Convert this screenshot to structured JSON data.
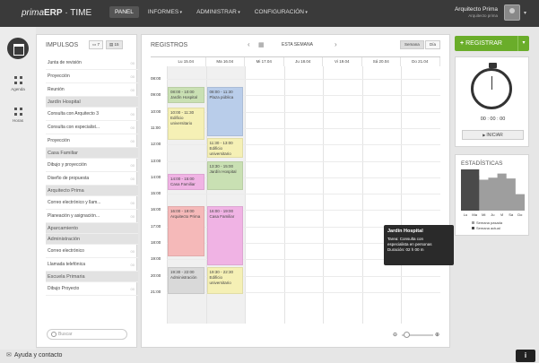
{
  "header": {
    "logo_italic": "prima",
    "logo_bold": "ERP",
    "logo_rest": " · TIME",
    "nav": [
      {
        "label": "PANEL",
        "active": true
      },
      {
        "label": "INFORMES",
        "caret": true
      },
      {
        "label": "ADMINISTRAR",
        "caret": true
      },
      {
        "label": "CONFIGURACIÓN",
        "caret": true
      }
    ],
    "user_name": "Arquitecto Prima",
    "user_role": "Arquitecto prima"
  },
  "left_nav": {
    "items": [
      {
        "label": "Agenda",
        "icon": "agenda-grid-icon"
      },
      {
        "label": "Horas",
        "icon": "hours-grid-icon"
      }
    ]
  },
  "impulsos": {
    "title": "IMPULSOS",
    "btn_day": "7",
    "btn_week": "15",
    "rows": [
      {
        "label": "Junta de revisión",
        "right": "00"
      },
      {
        "label": "Proyección",
        "right": "00"
      },
      {
        "label": "Reunión",
        "right": "00"
      },
      {
        "label": "Jardín Hospital",
        "group": true
      },
      {
        "label": "Consulta con Arquitecto 3",
        "right": "00"
      },
      {
        "label": "Consulta con especialist...",
        "right": "00"
      },
      {
        "label": "Proyección",
        "right": "00"
      },
      {
        "label": "Casa Familiar",
        "group": true
      },
      {
        "label": "Dibujo y proyección",
        "right": "00"
      },
      {
        "label": "Diseño de propuesta",
        "right": "00"
      },
      {
        "label": "Arquitecto Prima",
        "group": true
      },
      {
        "label": "Correo electrónico y llam...",
        "right": "00"
      },
      {
        "label": "Planeación y asignación...",
        "right": "00"
      },
      {
        "label": "Aparcamiento",
        "group": true
      },
      {
        "label": "Administración",
        "group": true
      },
      {
        "label": "Correo electrónico",
        "right": "00"
      },
      {
        "label": "Llamada telefónica",
        "right": "00"
      },
      {
        "label": "Escuela Primaria",
        "group": true
      },
      {
        "label": "Dibujo Proyecto",
        "right": "00"
      }
    ],
    "search_placeholder": "Buscar"
  },
  "registros": {
    "title": "REGISTROS",
    "week_label": "ESTA SEMANA",
    "toggle_week": "Semana",
    "toggle_day": "Día",
    "days": [
      "Lu 15.04",
      "Ma 16.04",
      "Mi 17.04",
      "Ju 18.04",
      "Vi 19.04",
      "Sá 20.04",
      "Do 21.04"
    ],
    "hours": [
      "08:00",
      "09:00",
      "10:00",
      "11:00",
      "12:00",
      "13:00",
      "14:00",
      "15:00",
      "16:00",
      "17:00",
      "18:00",
      "19:00",
      "20:00",
      "21:00"
    ],
    "events": [
      {
        "day": 0,
        "start": 8.5,
        "end": 9.5,
        "time": "08:00 - 10:00",
        "title": "Jardín Hospital",
        "color": "#c9e0b3"
      },
      {
        "day": 0,
        "start": 9.75,
        "end": 11.7,
        "time": "10:00 - 11:30",
        "title": "Edificio universitario",
        "color": "#f5f0b5"
      },
      {
        "day": 0,
        "start": 13.8,
        "end": 14.8,
        "time": "14:00 - 15:00",
        "title": "Casa Familiar",
        "color": "#f0b3e4"
      },
      {
        "day": 0,
        "start": 15.75,
        "end": 18.8,
        "time": "16:00 - 19:00",
        "title": "Arquitecto Prima",
        "color": "#f5b9b9"
      },
      {
        "day": 0,
        "start": 19.5,
        "end": 21.1,
        "time": "19:30 - 22:00",
        "title": "Administración",
        "color": "#d9d9d9"
      },
      {
        "day": 1,
        "start": 8.5,
        "end": 11.5,
        "time": "08:00 - 11:30",
        "title": "Plaza pública",
        "color": "#b9cdea"
      },
      {
        "day": 1,
        "start": 11.6,
        "end": 12.8,
        "time": "11:30 - 13:00",
        "title": "Edificio universitario",
        "color": "#f5f0b5"
      },
      {
        "day": 1,
        "start": 13.0,
        "end": 14.75,
        "time": "13:30 - 15:00",
        "title": "Jardín Hospital",
        "color": "#c9e0b3"
      },
      {
        "day": 1,
        "start": 15.75,
        "end": 19.35,
        "time": "16:00 - 19:00",
        "title": "Casa Familiar",
        "color": "#f0b3e4"
      },
      {
        "day": 1,
        "start": 19.5,
        "end": 21.1,
        "time": "19:30 - 22:30",
        "title": "Edificio universitario",
        "color": "#f5f0b5"
      }
    ],
    "tooltip": {
      "title": "Jardín Hospital",
      "line1": "Tarea: Consulta con",
      "line2": "especialista en personas",
      "duration": "Duración: 02 h 00 m"
    }
  },
  "registrar_label": "REGISTRAR",
  "timer": {
    "time": "00 : 00 : 00",
    "start_label": "INICIAR"
  },
  "stats": {
    "title": "ESTADÍSTICAS",
    "day_labels": [
      "Lu",
      "Ma",
      "Mi",
      "Ju",
      "Vi",
      "Sá",
      "Do"
    ],
    "legend": [
      "Semana pasada",
      "Semana actual"
    ]
  },
  "chart_data": {
    "type": "area",
    "categories": [
      "Lu",
      "Ma",
      "Mi",
      "Ju",
      "Vi",
      "Sá",
      "Do"
    ],
    "series": [
      {
        "name": "Semana pasada",
        "values": [
          0.6,
          0.85,
          0.75,
          0.8,
          0.9,
          0.78,
          0.4
        ]
      },
      {
        "name": "Semana actual",
        "values": [
          1.0,
          1.0,
          0,
          0,
          0,
          0,
          0
        ]
      }
    ],
    "colors": {
      "Semana pasada": "#9e9e9e",
      "Semana actual": "#4a4a4a"
    }
  },
  "footer": {
    "help": "Ayuda y contacto",
    "info": "i"
  }
}
